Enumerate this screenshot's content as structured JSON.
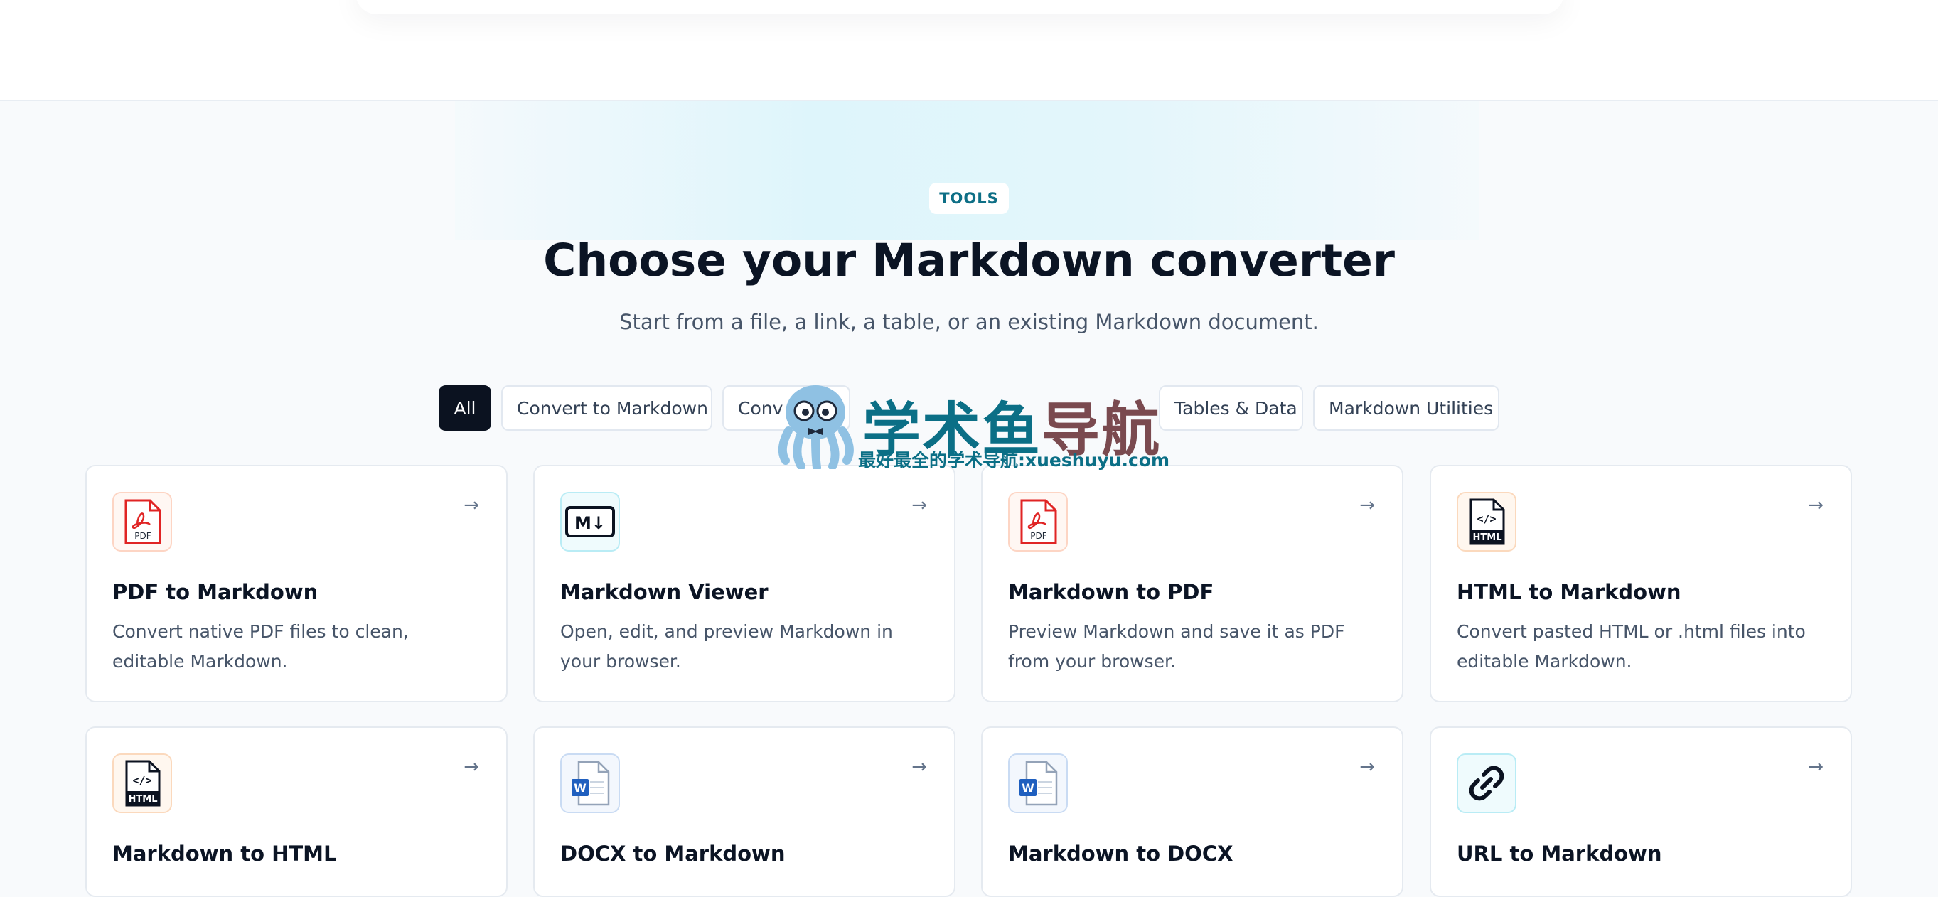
{
  "colors": {
    "accent": "#0e6f86",
    "primary_dark": "#0b1220",
    "pdf_red": "#e02424",
    "word_blue": "#2563eb"
  },
  "hero": {
    "eyebrow": "TOOLS",
    "title": "Choose your Markdown converter",
    "subtitle": "Start from a file, a link, a table, or an existing Markdown document."
  },
  "filters": [
    {
      "label": "All",
      "active": true
    },
    {
      "label": "Convert to Markdown",
      "active": false
    },
    {
      "label": "Conv",
      "active": false
    },
    {
      "label": "Tables & Data",
      "active": false
    },
    {
      "label": "Markdown Utilities",
      "active": false
    }
  ],
  "cards": [
    {
      "icon": "pdf-file-icon",
      "title": "PDF to Markdown",
      "description": "Convert native PDF files to clean, editable Markdown.",
      "arrow": "→"
    },
    {
      "icon": "markdown-icon",
      "title": "Markdown Viewer",
      "description": "Open, edit, and preview Markdown in your browser.",
      "arrow": "→"
    },
    {
      "icon": "pdf-file-icon",
      "title": "Markdown to PDF",
      "description": "Preview Markdown and save it as PDF from your browser.",
      "arrow": "→"
    },
    {
      "icon": "html-file-icon",
      "title": "HTML to Markdown",
      "description": "Convert pasted HTML or .html files into editable Markdown.",
      "arrow": "→"
    },
    {
      "icon": "html-file-icon",
      "title": "Markdown to HTML",
      "description": "",
      "arrow": "→"
    },
    {
      "icon": "word-file-icon",
      "title": "DOCX to Markdown",
      "description": "",
      "arrow": "→"
    },
    {
      "icon": "word-file-icon",
      "title": "Markdown to DOCX",
      "description": "",
      "arrow": "→"
    },
    {
      "icon": "link-icon",
      "title": "URL to Markdown",
      "description": "",
      "arrow": "→"
    }
  ],
  "icon_labels": {
    "pdf": "PDF",
    "markdown": "M↓",
    "html_tag": "</>",
    "html": "HTML",
    "word": "W"
  },
  "watermark": {
    "text_a": "学术鱼",
    "text_b": "导航",
    "subtitle": "最好最全的学术导航:xueshuyu.com"
  }
}
